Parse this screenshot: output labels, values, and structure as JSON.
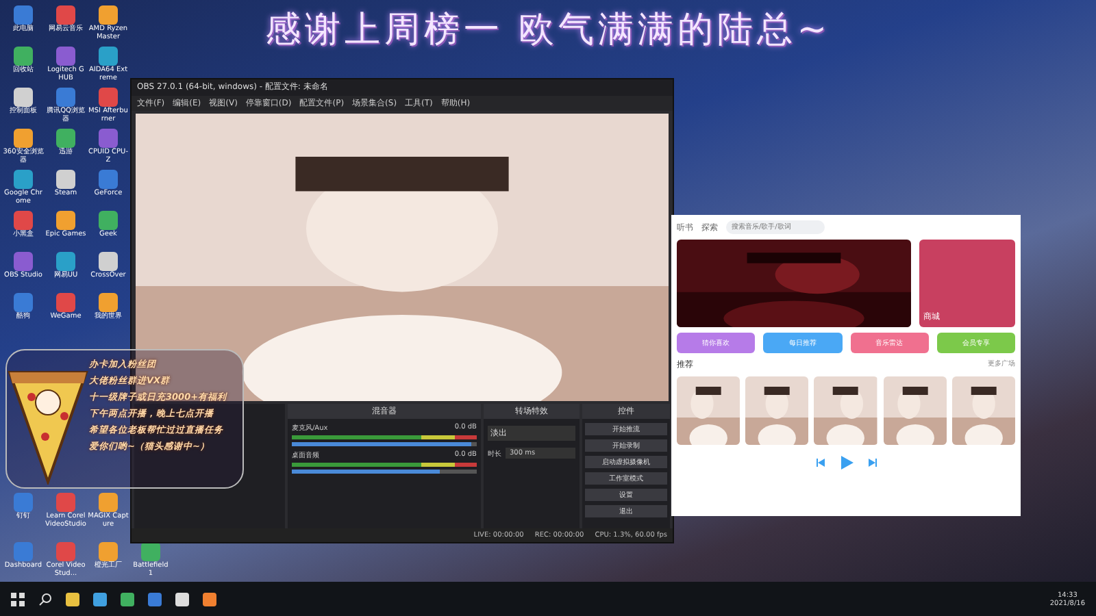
{
  "banner": {
    "text": "感谢上周榜一 欧气满满的陆总~"
  },
  "desktop_icons": [
    {
      "label": "此电脑"
    },
    {
      "label": "网易云音乐"
    },
    {
      "label": "AMD Ryzen Master"
    },
    {
      "label": "回收站"
    },
    {
      "label": "Logitech G HUB"
    },
    {
      "label": "AIDA64 Extreme"
    },
    {
      "label": "控制面板"
    },
    {
      "label": "腾讯QQ浏览器"
    },
    {
      "label": "MSI Afterburner"
    },
    {
      "label": "360安全浏览器"
    },
    {
      "label": "迅游"
    },
    {
      "label": "CPUID CPU-Z"
    },
    {
      "label": "Google Chrome"
    },
    {
      "label": "Steam"
    },
    {
      "label": "GeForce"
    },
    {
      "label": "小黑盒"
    },
    {
      "label": "Epic Games"
    },
    {
      "label": "Geek"
    },
    {
      "label": "OBS Studio"
    },
    {
      "label": "网易UU"
    },
    {
      "label": "CrossOver"
    },
    {
      "label": "酷狗"
    },
    {
      "label": "WeGame"
    },
    {
      "label": "我的世界"
    }
  ],
  "desktop_icons_bottom": [
    {
      "label": "钉钉"
    },
    {
      "label": "Learn Corel VideoStudio"
    },
    {
      "label": "MAGIX Capture"
    },
    {
      "label": "Dashboard"
    },
    {
      "label": "Corel VideoStud..."
    },
    {
      "label": "橙光工厂"
    },
    {
      "label": "Battlefield 1"
    }
  ],
  "overlay": {
    "lines": [
      "办卡加入粉丝团",
      "大佬粉丝群进VX群",
      "十一级牌子或日充3000+有福利",
      "下午两点开播，晚上七点开播",
      "希望各位老板帮忙过过直播任务",
      "爱你们哟~（猫头感谢中~）"
    ]
  },
  "obs": {
    "title": "OBS 27.0.1 (64-bit, windows) - 配置文件: 未命名",
    "menu": [
      "文件(F)",
      "编辑(E)",
      "视图(V)",
      "停靠窗口(D)",
      "配置文件(P)",
      "场景集合(S)",
      "工具(T)",
      "帮助(H)"
    ],
    "mixer": {
      "header": "混音器",
      "channels": [
        {
          "name": "麦克风/Aux",
          "reading": "0.0 dB",
          "level": 0.97
        },
        {
          "name": "桌面音频",
          "reading": "0.0 dB",
          "level": 0.8
        }
      ]
    },
    "transitions": {
      "header": "转场特效",
      "type": "淡出",
      "duration_label": "时长",
      "duration": "300 ms"
    },
    "controls": {
      "header": "控件",
      "buttons": [
        "开始推流",
        "开始录制",
        "启动虚拟摄像机",
        "工作室模式",
        "设置",
        "退出"
      ]
    },
    "status_bar": [
      "LIVE: 00:00:00",
      "REC: 00:00:00",
      "CPU: 1.3%, 60.00 fps"
    ]
  },
  "music": {
    "nav": [
      "听书",
      "探索"
    ],
    "search": {
      "placeholder": "搜索音乐/歌手/歌词"
    },
    "gift_card": {
      "title": "商城"
    },
    "tiles": [
      {
        "label": "猜你喜欢",
        "color": "#b67be8"
      },
      {
        "label": "每日推荐",
        "color": "#4aa8f5"
      },
      {
        "label": "音乐雷达",
        "color": "#f0708f"
      },
      {
        "label": "会员专享",
        "color": "#7cc94a"
      }
    ],
    "section": "推荐",
    "more": "更多广场"
  },
  "taskbar": {
    "time": "14:33",
    "date": "2021/8/16"
  }
}
